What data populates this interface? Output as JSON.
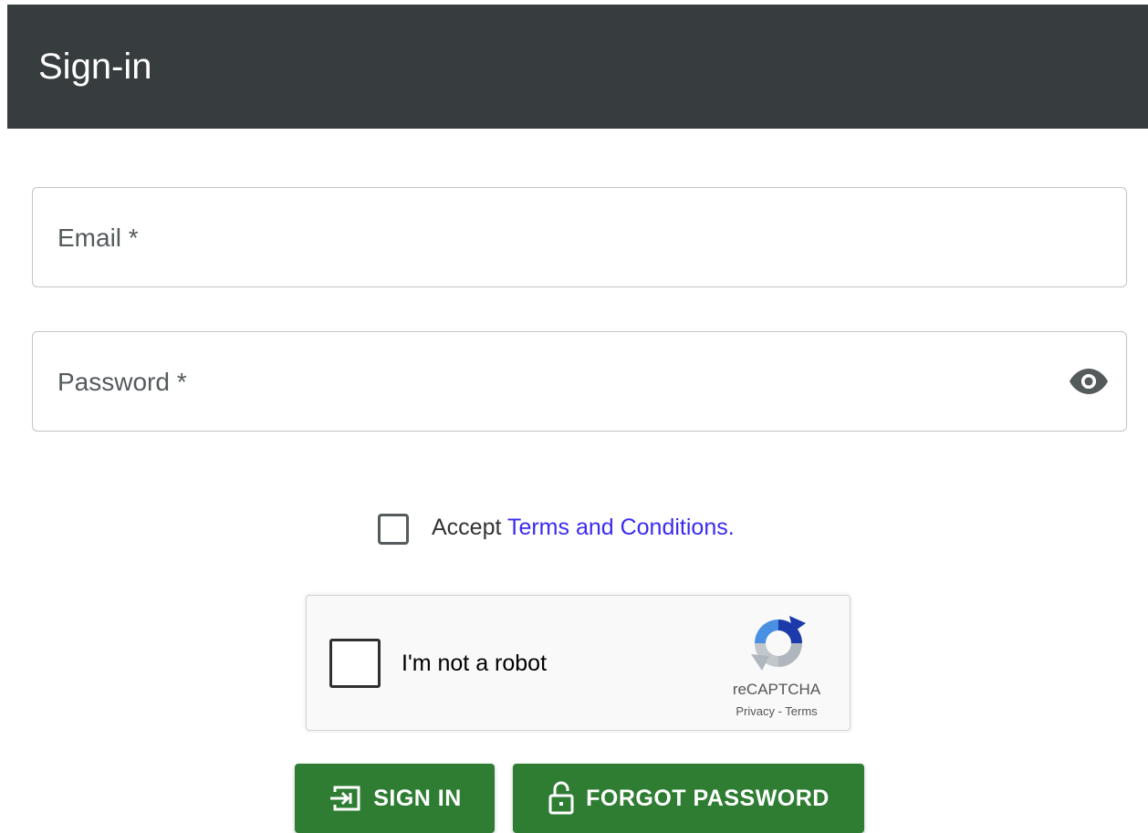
{
  "header": {
    "title": "Sign-in"
  },
  "form": {
    "email_label": "Email *",
    "password_label": "Password *",
    "accept_prefix": "Accept ",
    "terms_link": "Terms and Conditions."
  },
  "recaptcha": {
    "label": "I'm not a robot",
    "brand": "reCAPTCHA",
    "privacy": "Privacy",
    "separator": " - ",
    "terms": "Terms"
  },
  "buttons": {
    "sign_in": "SIGN IN",
    "forgot_password": "FORGOT PASSWORD"
  },
  "icons": {
    "visibility": "eye-icon",
    "sign_in": "login-icon",
    "forgot": "lock-open-icon",
    "recaptcha": "recaptcha-logo"
  },
  "colors": {
    "header_bg": "#373c3e",
    "button_bg": "#2e7d32",
    "link": "#3a2bf0"
  }
}
